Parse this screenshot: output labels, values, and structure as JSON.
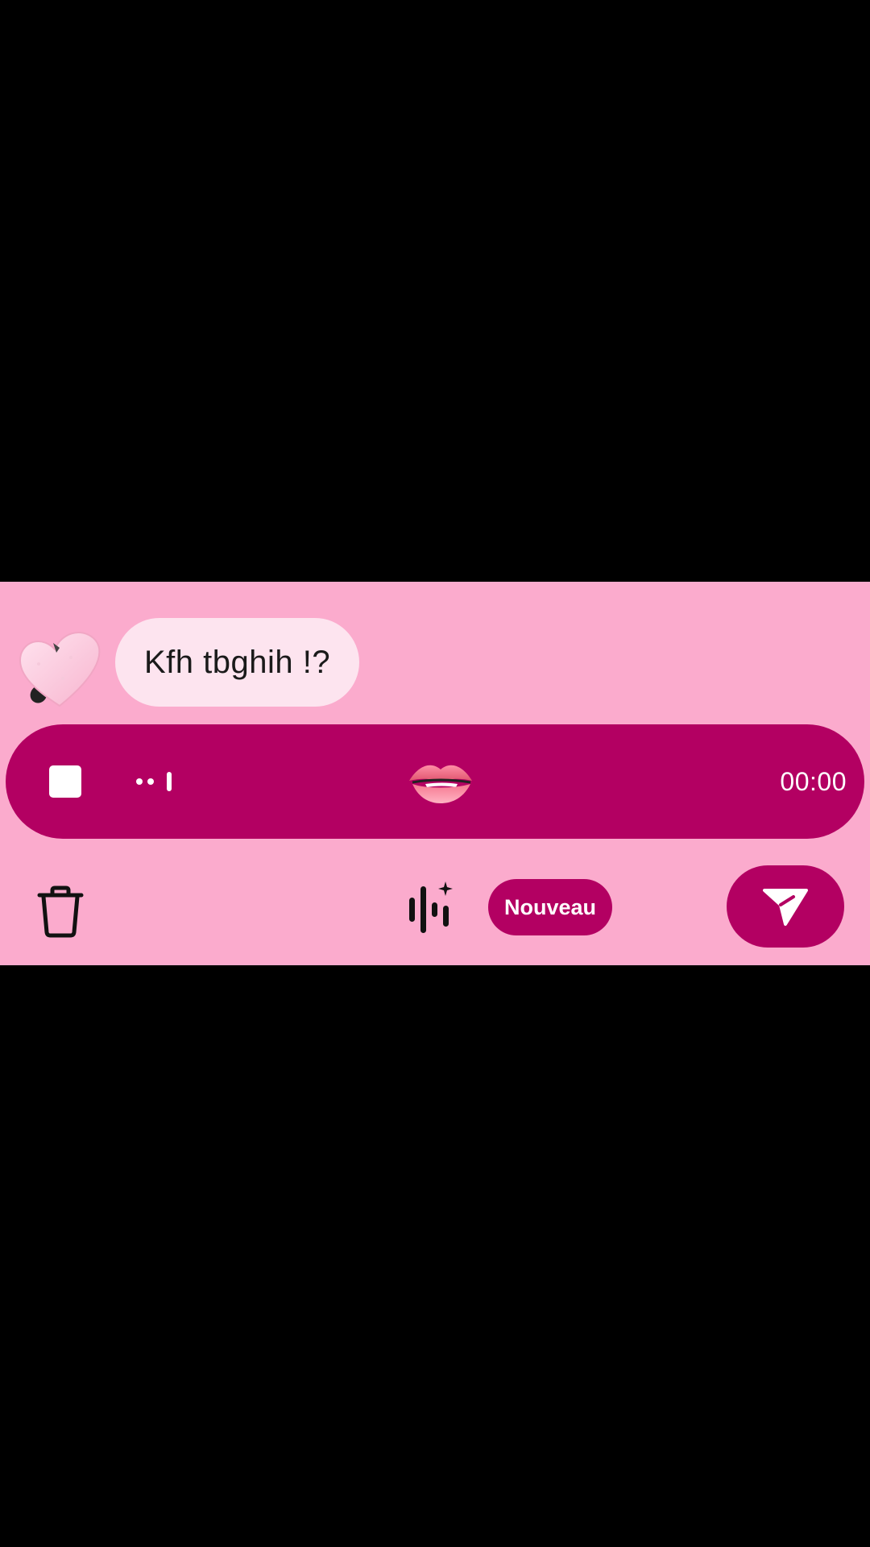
{
  "message": {
    "text": "Kfh tbghih !?"
  },
  "recording": {
    "timer": "00:00",
    "stop_icon": "stop-icon",
    "waveform_icon": "waveform-icon",
    "emoji": "biting-lip-emoji"
  },
  "toolbar": {
    "trash_icon": "trash-icon",
    "ai_voice_icon": "ai-voice-effect-icon",
    "new_badge_label": "Nouveau",
    "send_icon": "send-icon"
  },
  "colors": {
    "panel_background": "#fbabcd",
    "accent": "#b30062",
    "bubble": "#fde4ef",
    "page_background": "#000000"
  }
}
